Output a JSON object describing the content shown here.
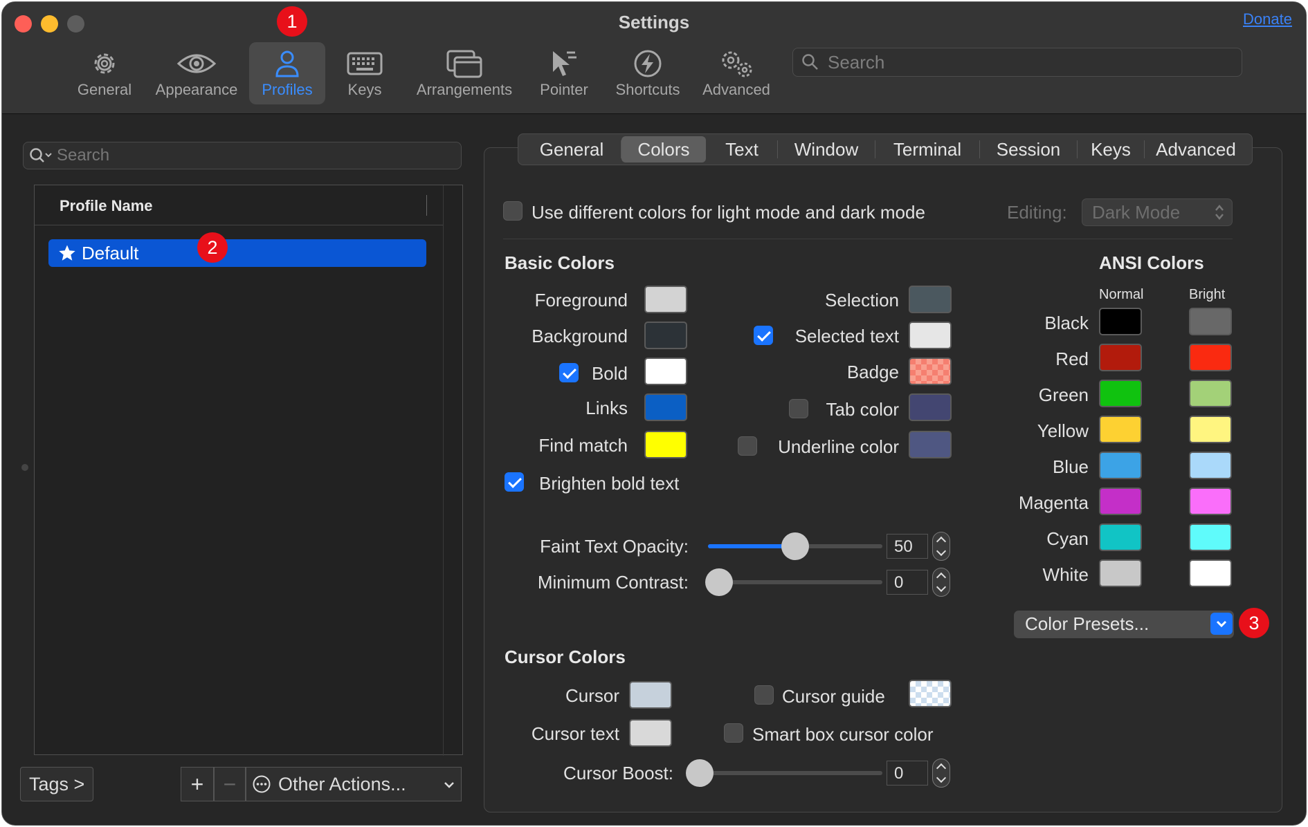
{
  "window": {
    "title": "Settings",
    "donate": "Donate"
  },
  "toolbar": {
    "items": [
      {
        "label": "General",
        "icon": "gear-icon"
      },
      {
        "label": "Appearance",
        "icon": "eye-icon"
      },
      {
        "label": "Profiles",
        "icon": "person-icon"
      },
      {
        "label": "Keys",
        "icon": "keyboard-icon"
      },
      {
        "label": "Arrangements",
        "icon": "windows-icon"
      },
      {
        "label": "Pointer",
        "icon": "pointer-icon"
      },
      {
        "label": "Shortcuts",
        "icon": "bolt-icon"
      },
      {
        "label": "Advanced",
        "icon": "gears-icon"
      }
    ],
    "active": "Profiles",
    "search_placeholder": "Search"
  },
  "annotations": [
    "1",
    "2",
    "3"
  ],
  "profiles": {
    "search_placeholder": "Search",
    "column_header": "Profile Name",
    "items": [
      {
        "name": "Default",
        "default": true
      }
    ],
    "tags_button": "Tags >",
    "add": "+",
    "remove": "−",
    "other_actions": "Other Actions..."
  },
  "subtabs": {
    "items": [
      "General",
      "Colors",
      "Text",
      "Window",
      "Terminal",
      "Session",
      "Keys",
      "Advanced"
    ],
    "active": "Colors"
  },
  "colors": {
    "mode_checkbox": "Use different colors for light mode and dark mode",
    "editing_label": "Editing:",
    "editing_value": "Dark Mode",
    "basic_header": "Basic Colors",
    "basic": {
      "foreground": {
        "label": "Foreground",
        "color": "#d3d3d3"
      },
      "background": {
        "label": "Background",
        "color": "#2c3237"
      },
      "bold": {
        "label": "Bold",
        "color": "#ffffff",
        "checked": true
      },
      "links": {
        "label": "Links",
        "color": "#0b5fc4"
      },
      "find_match": {
        "label": "Find match",
        "color": "#ffff00"
      },
      "selection": {
        "label": "Selection",
        "color": "#4b585f"
      },
      "selected_text": {
        "label": "Selected text",
        "color": "#e6e6e6",
        "checked": true
      },
      "badge": {
        "label": "Badge",
        "color": "#f57f70"
      },
      "tab_color": {
        "label": "Tab color",
        "color": "#434671",
        "checked": false
      },
      "underline_color": {
        "label": "Underline color",
        "color": "#4f5782",
        "checked": false
      }
    },
    "brighten_bold": {
      "label": "Brighten bold text",
      "checked": true
    },
    "faint_opacity": {
      "label": "Faint Text Opacity:",
      "value": "50",
      "fraction": 0.5
    },
    "min_contrast": {
      "label": "Minimum Contrast:",
      "value": "0",
      "fraction": 0
    },
    "ansi_header": "ANSI Colors",
    "ansi_normal_label": "Normal",
    "ansi_bright_label": "Bright",
    "ansi": [
      {
        "name": "Black",
        "normal": "#000000",
        "bright": "#686868"
      },
      {
        "name": "Red",
        "normal": "#b21b0c",
        "bright": "#fa2a10"
      },
      {
        "name": "Green",
        "normal": "#10c20f",
        "bright": "#a3d178"
      },
      {
        "name": "Yellow",
        "normal": "#fdd132",
        "bright": "#fff580"
      },
      {
        "name": "Blue",
        "normal": "#3ca3e6",
        "bright": "#aad9fa"
      },
      {
        "name": "Magenta",
        "normal": "#c42fc8",
        "bright": "#fa6efa"
      },
      {
        "name": "Cyan",
        "normal": "#11c4c5",
        "bright": "#5ffbfb"
      },
      {
        "name": "White",
        "normal": "#c8c8c8",
        "bright": "#ffffff"
      }
    ],
    "color_presets": "Color Presets...",
    "cursor_header": "Cursor Colors",
    "cursor": {
      "label": "Cursor",
      "color": "#c6d1dc"
    },
    "cursor_text": {
      "label": "Cursor text",
      "color": "#d9d9d9"
    },
    "cursor_guide": {
      "label": "Cursor guide",
      "checked": false
    },
    "smart_box": {
      "label": "Smart box cursor color",
      "checked": false
    },
    "cursor_boost": {
      "label": "Cursor Boost:",
      "value": "0",
      "fraction": 0
    }
  }
}
